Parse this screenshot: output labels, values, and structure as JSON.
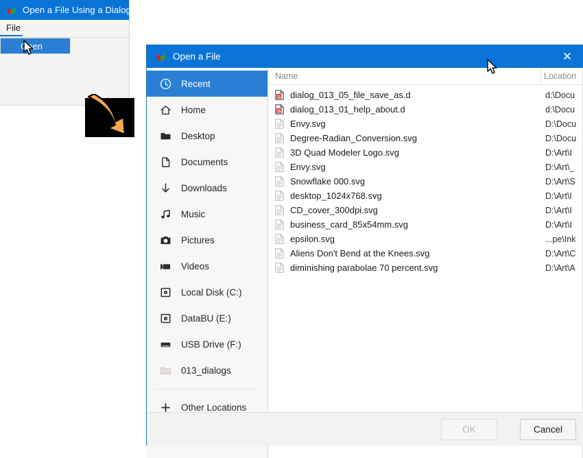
{
  "background_window": {
    "title": "Open a File Using a Dialog",
    "title_icon": "cube-icon",
    "menubar": {
      "file_label": "File"
    },
    "menu_popup": {
      "open_label": "Open"
    }
  },
  "dialog": {
    "title": "Open a File",
    "title_icon": "cube-icon",
    "close_label": "✕",
    "sidebar": {
      "items": [
        {
          "label": "Recent",
          "icon": "clock-icon",
          "active": true
        },
        {
          "label": "Home",
          "icon": "home-icon",
          "active": false
        },
        {
          "label": "Desktop",
          "icon": "folder-icon",
          "active": false
        },
        {
          "label": "Documents",
          "icon": "document-icon",
          "active": false
        },
        {
          "label": "Downloads",
          "icon": "download-arrow-icon",
          "active": false
        },
        {
          "label": "Music",
          "icon": "music-note-icon",
          "active": false
        },
        {
          "label": "Pictures",
          "icon": "camera-icon",
          "active": false
        },
        {
          "label": "Videos",
          "icon": "video-icon",
          "active": false
        },
        {
          "label": "Local Disk (C:)",
          "icon": "harddisk-icon",
          "active": false
        },
        {
          "label": "DataBU (E:)",
          "icon": "harddisk-icon",
          "active": false
        },
        {
          "label": "USB Drive (F:)",
          "icon": "usb-drive-icon",
          "active": false
        },
        {
          "label": "013_dialogs",
          "icon": "folder-icon",
          "active": false
        }
      ],
      "other_locations": {
        "label": "Other Locations",
        "icon": "plus-icon"
      }
    },
    "file_list": {
      "columns": [
        "Name",
        "Location"
      ],
      "rows": [
        {
          "name": "dialog_013_05_file_save_as.d",
          "location": "d:\\Docu",
          "icon": "doc-red-icon"
        },
        {
          "name": "dialog_013_01_help_about.d",
          "location": "d:\\Docu",
          "icon": "doc-red-icon"
        },
        {
          "name": "Envy.svg",
          "location": "D:\\Docu",
          "icon": "doc-gray-icon"
        },
        {
          "name": "Degree-Radian_Conversion.svg",
          "location": "D:\\Docu",
          "icon": "doc-gray-icon"
        },
        {
          "name": "3D Quad Modeler Logo.svg",
          "location": "D:\\Art\\I",
          "icon": "doc-gray-icon"
        },
        {
          "name": "Envy.svg",
          "location": "D:\\Art\\_",
          "icon": "doc-gray-icon"
        },
        {
          "name": "Snowflake 000.svg",
          "location": "D:\\Art\\S",
          "icon": "doc-gray-icon"
        },
        {
          "name": "desktop_1024x768.svg",
          "location": "D:\\Art\\I",
          "icon": "doc-gray-icon"
        },
        {
          "name": "CD_cover_300dpi.svg",
          "location": "D:\\Art\\I",
          "icon": "doc-gray-icon"
        },
        {
          "name": "business_card_85x54mm.svg",
          "location": "D:\\Art\\I",
          "icon": "doc-gray-icon"
        },
        {
          "name": "epsilon.svg",
          "location": "...pe\\Ink",
          "icon": "doc-gray-icon"
        },
        {
          "name": "Aliens Don't Bend at the Knees.svg",
          "location": "D:\\Art\\C",
          "icon": "doc-gray-icon"
        },
        {
          "name": "diminishing parabolae 70 percent.svg",
          "location": "D:\\Art\\A",
          "icon": "doc-gray-icon"
        }
      ]
    },
    "footer": {
      "ok_label": "OK",
      "ok_enabled": false,
      "cancel_label": "Cancel"
    }
  },
  "annotation": {
    "type": "curved-arrow",
    "color": "#f5a855",
    "direction": "down-right"
  },
  "colors": {
    "titlebar_blue": "#0a74d6",
    "selection_blue": "#2a7fd4",
    "arrow_orange": "#f5a855",
    "doc_red": "#c9252c"
  }
}
